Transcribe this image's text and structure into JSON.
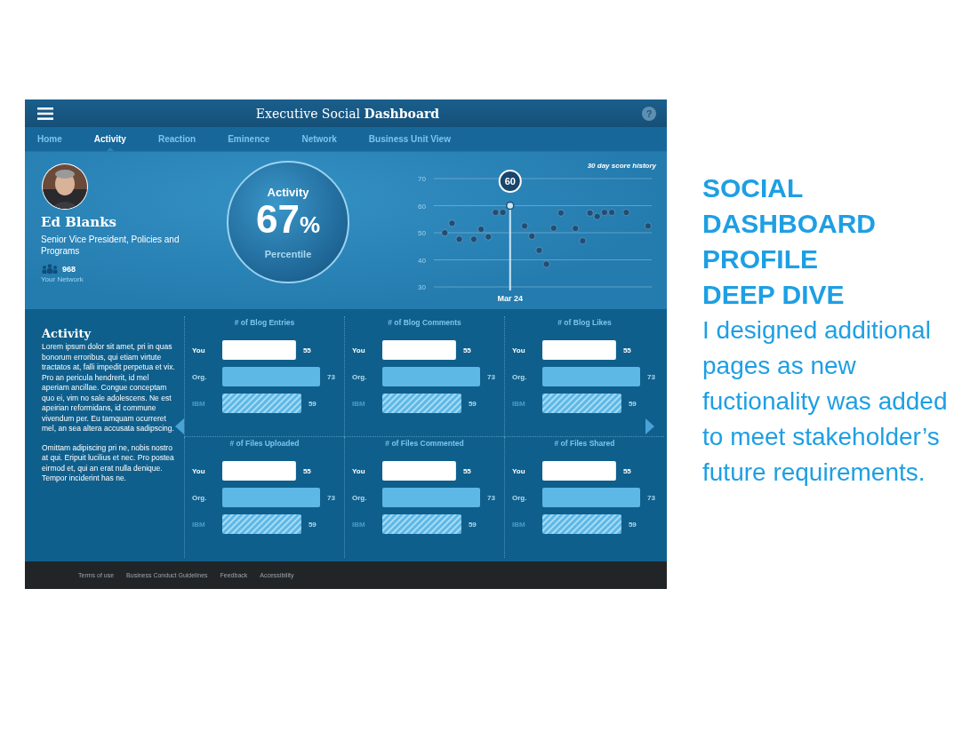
{
  "app": {
    "title": "Executive Social **Dashboard**",
    "help": "?"
  },
  "tabs": [
    {
      "label": "Home",
      "selected": false
    },
    {
      "label": "Activity",
      "selected": true
    },
    {
      "label": "Reaction",
      "selected": false
    },
    {
      "label": "Eminence",
      "selected": false
    },
    {
      "label": "Network",
      "selected": false
    },
    {
      "label": "Business Unit View",
      "selected": false
    }
  ],
  "profile": {
    "name": "Ed Blanks",
    "role": "Senior Vice President, Policies and Programs",
    "network_count": "968",
    "network_label": "Your Network"
  },
  "score": {
    "label": "Activity",
    "value": "67",
    "unit": "%",
    "caption": "Percentile"
  },
  "history": {
    "chart_data": {
      "type": "scatter",
      "title": "30 day score history",
      "values": [
        null,
        50,
        53.5,
        47.6,
        null,
        47.6,
        51.3,
        48.5,
        57.5,
        57.5,
        60,
        null,
        52.5,
        48.7,
        43.5,
        38.4,
        51.7,
        57.3,
        null,
        51.6,
        47,
        57.3,
        56,
        57.5,
        57.5,
        null,
        57.5,
        null,
        null,
        52.5
      ],
      "ylim": [
        30,
        70
      ],
      "yticks": [
        30,
        40,
        50,
        60,
        70
      ],
      "grid": true,
      "annotations": [
        "60",
        "Mar 24"
      ]
    }
  },
  "activity": {
    "heading": "Activity",
    "paragraphs": [
      "Lorem ipsum dolor sit amet, pri in quas bonorum erroribus, qui etiam virtute tractatos at, falli impedit perpetua et vix. Pro an pericula hendrerit, id mel aperiam ancillae. Congue conceptam quo ei, vim no sale adolescens. Ne est apeirian reformidans, id commune vivendum per. Eu tamquam ocurreret mel, an sea altera accusata sadipscing.",
      "Omittam adipiscing pri ne, nobis nostro at qui. Eripuit lucilius et nec. Pro postea eirmod et, qui an erat nulla denique. Tempor inciderint has ne."
    ]
  },
  "metrics": [
    {
      "chart_data": {
        "type": "bar",
        "orientation": "horizontal",
        "title": "# of Blog Entries",
        "categories": [
          "You",
          "Org.",
          "IBM"
        ],
        "values": [
          55,
          73,
          59
        ],
        "data_labels": true
      }
    },
    {
      "chart_data": {
        "type": "bar",
        "orientation": "horizontal",
        "title": "# of Blog Comments",
        "categories": [
          "You",
          "Org.",
          "IBM"
        ],
        "values": [
          55,
          73,
          59
        ],
        "data_labels": true
      }
    },
    {
      "chart_data": {
        "type": "bar",
        "orientation": "horizontal",
        "title": "# of Blog Likes",
        "categories": [
          "You",
          "Org.",
          "IBM"
        ],
        "values": [
          55,
          73,
          59
        ],
        "data_labels": true
      }
    },
    {
      "chart_data": {
        "type": "bar",
        "orientation": "horizontal",
        "title": "# of Files Uploaded",
        "categories": [
          "You",
          "Org.",
          "IBM"
        ],
        "values": [
          55,
          73,
          59
        ],
        "data_labels": true
      }
    },
    {
      "chart_data": {
        "type": "bar",
        "orientation": "horizontal",
        "title": "# of Files Commented",
        "categories": [
          "You",
          "Org.",
          "IBM"
        ],
        "values": [
          55,
          73,
          59
        ],
        "data_labels": true
      }
    },
    {
      "chart_data": {
        "type": "bar",
        "orientation": "horizontal",
        "title": "# of Files Shared",
        "categories": [
          "You",
          "Org.",
          "IBM"
        ],
        "values": [
          55,
          73,
          59
        ],
        "data_labels": true
      }
    }
  ],
  "footer": {
    "links": [
      "Terms of use",
      "Business Conduct Guidelines",
      "Feedback",
      "Accessibility"
    ]
  },
  "slide": {
    "heading": "SOCIAL DASHBOARD PROFILE DEEP DIVE",
    "body": "I designed additional pages as new fuctionality was added to meet stakeholder’s future requirements."
  }
}
